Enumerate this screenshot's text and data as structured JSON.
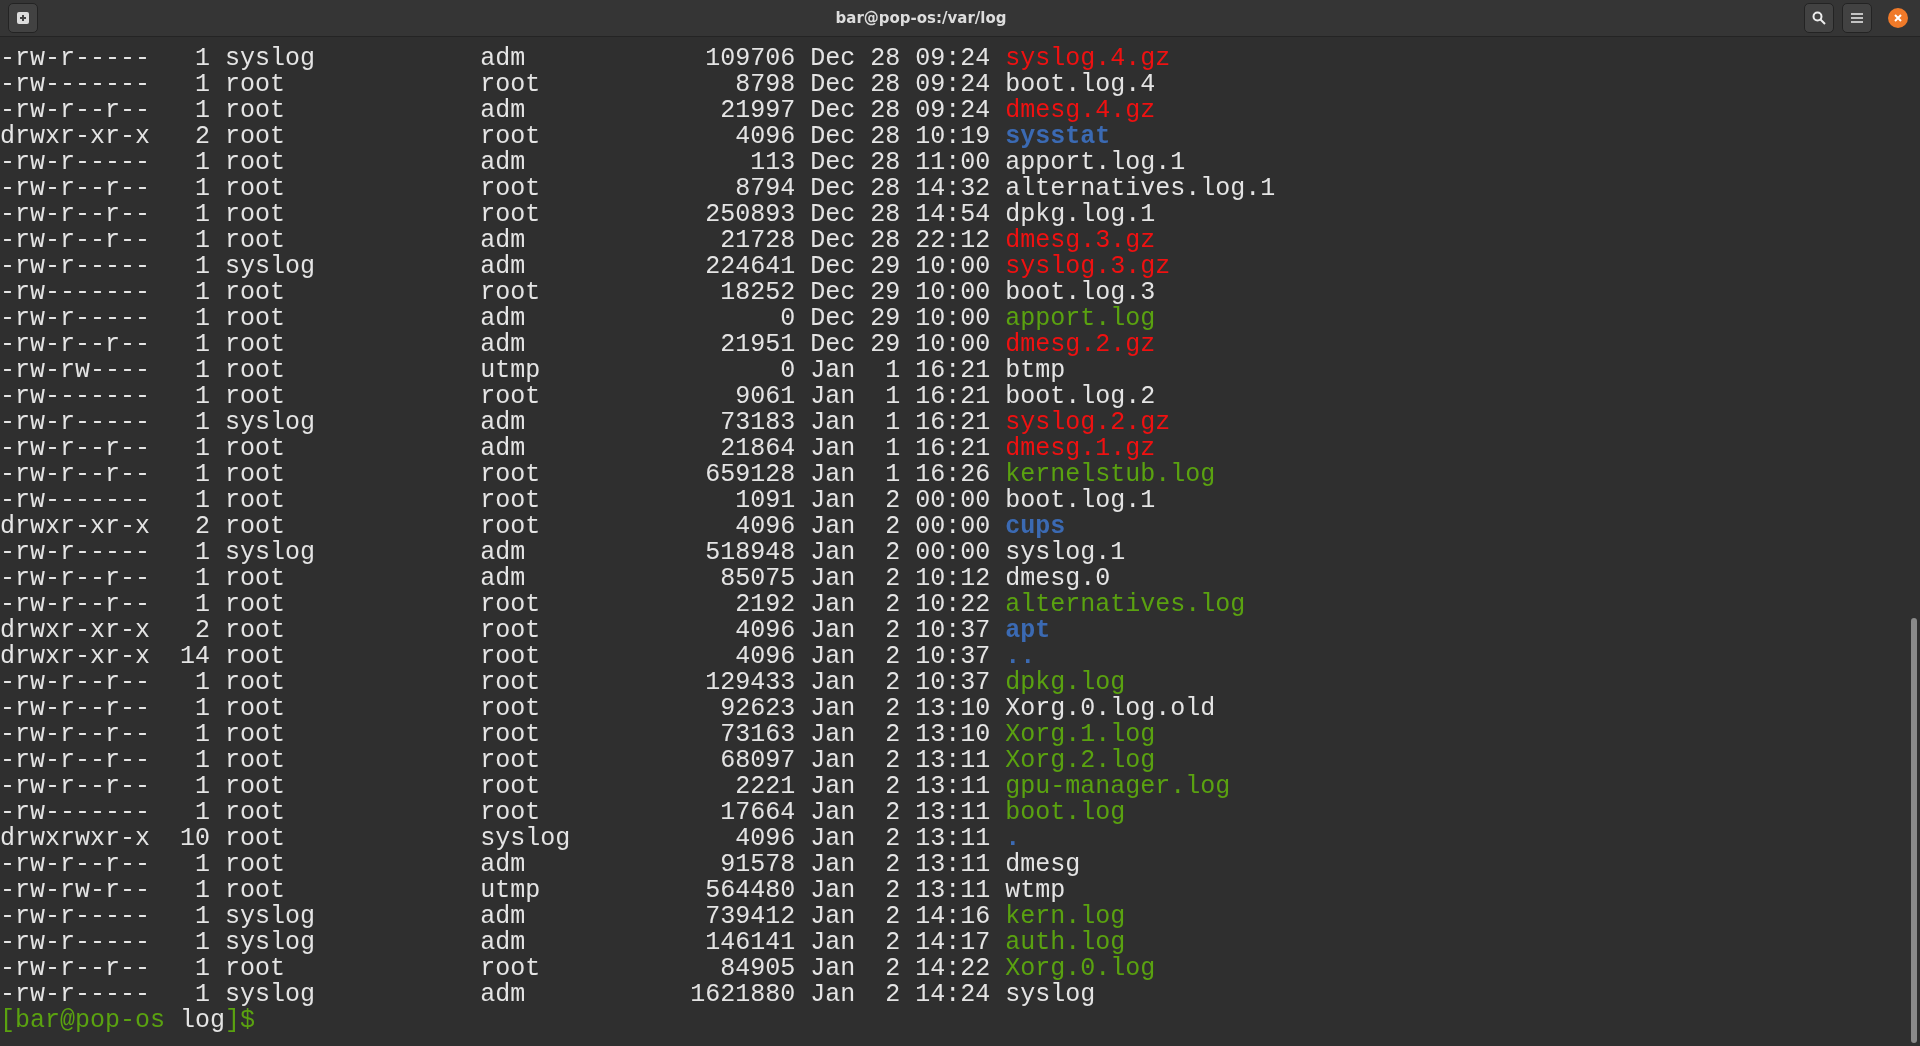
{
  "window": {
    "title": "bar@pop-os:/var/log"
  },
  "listing": [
    {
      "permissions": "-rw-r-----",
      "links": "1",
      "owner": "syslog",
      "group": "adm",
      "size": "109706",
      "month": "Dec",
      "day": "28",
      "time": "09:24",
      "name": "syslog.4.gz",
      "kind": "archive"
    },
    {
      "permissions": "-rw-------",
      "links": "1",
      "owner": "root",
      "group": "root",
      "size": "8798",
      "month": "Dec",
      "day": "28",
      "time": "09:24",
      "name": "boot.log.4",
      "kind": "file"
    },
    {
      "permissions": "-rw-r--r--",
      "links": "1",
      "owner": "root",
      "group": "adm",
      "size": "21997",
      "month": "Dec",
      "day": "28",
      "time": "09:24",
      "name": "dmesg.4.gz",
      "kind": "archive"
    },
    {
      "permissions": "drwxr-xr-x",
      "links": "2",
      "owner": "root",
      "group": "root",
      "size": "4096",
      "month": "Dec",
      "day": "28",
      "time": "10:19",
      "name": "sysstat",
      "kind": "directory"
    },
    {
      "permissions": "-rw-r-----",
      "links": "1",
      "owner": "root",
      "group": "adm",
      "size": "113",
      "month": "Dec",
      "day": "28",
      "time": "11:00",
      "name": "apport.log.1",
      "kind": "file"
    },
    {
      "permissions": "-rw-r--r--",
      "links": "1",
      "owner": "root",
      "group": "root",
      "size": "8794",
      "month": "Dec",
      "day": "28",
      "time": "14:32",
      "name": "alternatives.log.1",
      "kind": "file"
    },
    {
      "permissions": "-rw-r--r--",
      "links": "1",
      "owner": "root",
      "group": "root",
      "size": "250893",
      "month": "Dec",
      "day": "28",
      "time": "14:54",
      "name": "dpkg.log.1",
      "kind": "file"
    },
    {
      "permissions": "-rw-r--r--",
      "links": "1",
      "owner": "root",
      "group": "adm",
      "size": "21728",
      "month": "Dec",
      "day": "28",
      "time": "22:12",
      "name": "dmesg.3.gz",
      "kind": "archive"
    },
    {
      "permissions": "-rw-r-----",
      "links": "1",
      "owner": "syslog",
      "group": "adm",
      "size": "224641",
      "month": "Dec",
      "day": "29",
      "time": "10:00",
      "name": "syslog.3.gz",
      "kind": "archive"
    },
    {
      "permissions": "-rw-------",
      "links": "1",
      "owner": "root",
      "group": "root",
      "size": "18252",
      "month": "Dec",
      "day": "29",
      "time": "10:00",
      "name": "boot.log.3",
      "kind": "file"
    },
    {
      "permissions": "-rw-r-----",
      "links": "1",
      "owner": "root",
      "group": "adm",
      "size": "0",
      "month": "Dec",
      "day": "29",
      "time": "10:00",
      "name": "apport.log",
      "kind": "executable"
    },
    {
      "permissions": "-rw-r--r--",
      "links": "1",
      "owner": "root",
      "group": "adm",
      "size": "21951",
      "month": "Dec",
      "day": "29",
      "time": "10:00",
      "name": "dmesg.2.gz",
      "kind": "archive"
    },
    {
      "permissions": "-rw-rw----",
      "links": "1",
      "owner": "root",
      "group": "utmp",
      "size": "0",
      "month": "Jan",
      "day": "1",
      "time": "16:21",
      "name": "btmp",
      "kind": "file"
    },
    {
      "permissions": "-rw-------",
      "links": "1",
      "owner": "root",
      "group": "root",
      "size": "9061",
      "month": "Jan",
      "day": "1",
      "time": "16:21",
      "name": "boot.log.2",
      "kind": "file"
    },
    {
      "permissions": "-rw-r-----",
      "links": "1",
      "owner": "syslog",
      "group": "adm",
      "size": "73183",
      "month": "Jan",
      "day": "1",
      "time": "16:21",
      "name": "syslog.2.gz",
      "kind": "archive"
    },
    {
      "permissions": "-rw-r--r--",
      "links": "1",
      "owner": "root",
      "group": "adm",
      "size": "21864",
      "month": "Jan",
      "day": "1",
      "time": "16:21",
      "name": "dmesg.1.gz",
      "kind": "archive"
    },
    {
      "permissions": "-rw-r--r--",
      "links": "1",
      "owner": "root",
      "group": "root",
      "size": "659128",
      "month": "Jan",
      "day": "1",
      "time": "16:26",
      "name": "kernelstub.log",
      "kind": "executable"
    },
    {
      "permissions": "-rw-------",
      "links": "1",
      "owner": "root",
      "group": "root",
      "size": "1091",
      "month": "Jan",
      "day": "2",
      "time": "00:00",
      "name": "boot.log.1",
      "kind": "file"
    },
    {
      "permissions": "drwxr-xr-x",
      "links": "2",
      "owner": "root",
      "group": "root",
      "size": "4096",
      "month": "Jan",
      "day": "2",
      "time": "00:00",
      "name": "cups",
      "kind": "directory"
    },
    {
      "permissions": "-rw-r-----",
      "links": "1",
      "owner": "syslog",
      "group": "adm",
      "size": "518948",
      "month": "Jan",
      "day": "2",
      "time": "00:00",
      "name": "syslog.1",
      "kind": "file"
    },
    {
      "permissions": "-rw-r--r--",
      "links": "1",
      "owner": "root",
      "group": "adm",
      "size": "85075",
      "month": "Jan",
      "day": "2",
      "time": "10:12",
      "name": "dmesg.0",
      "kind": "file"
    },
    {
      "permissions": "-rw-r--r--",
      "links": "1",
      "owner": "root",
      "group": "root",
      "size": "2192",
      "month": "Jan",
      "day": "2",
      "time": "10:22",
      "name": "alternatives.log",
      "kind": "executable"
    },
    {
      "permissions": "drwxr-xr-x",
      "links": "2",
      "owner": "root",
      "group": "root",
      "size": "4096",
      "month": "Jan",
      "day": "2",
      "time": "10:37",
      "name": "apt",
      "kind": "directory"
    },
    {
      "permissions": "drwxr-xr-x",
      "links": "14",
      "owner": "root",
      "group": "root",
      "size": "4096",
      "month": "Jan",
      "day": "2",
      "time": "10:37",
      "name": "..",
      "kind": "directory"
    },
    {
      "permissions": "-rw-r--r--",
      "links": "1",
      "owner": "root",
      "group": "root",
      "size": "129433",
      "month": "Jan",
      "day": "2",
      "time": "10:37",
      "name": "dpkg.log",
      "kind": "executable"
    },
    {
      "permissions": "-rw-r--r--",
      "links": "1",
      "owner": "root",
      "group": "root",
      "size": "92623",
      "month": "Jan",
      "day": "2",
      "time": "13:10",
      "name": "Xorg.0.log.old",
      "kind": "file"
    },
    {
      "permissions": "-rw-r--r--",
      "links": "1",
      "owner": "root",
      "group": "root",
      "size": "73163",
      "month": "Jan",
      "day": "2",
      "time": "13:10",
      "name": "Xorg.1.log",
      "kind": "executable"
    },
    {
      "permissions": "-rw-r--r--",
      "links": "1",
      "owner": "root",
      "group": "root",
      "size": "68097",
      "month": "Jan",
      "day": "2",
      "time": "13:11",
      "name": "Xorg.2.log",
      "kind": "executable"
    },
    {
      "permissions": "-rw-r--r--",
      "links": "1",
      "owner": "root",
      "group": "root",
      "size": "2221",
      "month": "Jan",
      "day": "2",
      "time": "13:11",
      "name": "gpu-manager.log",
      "kind": "executable"
    },
    {
      "permissions": "-rw-------",
      "links": "1",
      "owner": "root",
      "group": "root",
      "size": "17664",
      "month": "Jan",
      "day": "2",
      "time": "13:11",
      "name": "boot.log",
      "kind": "executable"
    },
    {
      "permissions": "drwxrwxr-x",
      "links": "10",
      "owner": "root",
      "group": "syslog",
      "size": "4096",
      "month": "Jan",
      "day": "2",
      "time": "13:11",
      "name": ".",
      "kind": "directory"
    },
    {
      "permissions": "-rw-r--r--",
      "links": "1",
      "owner": "root",
      "group": "adm",
      "size": "91578",
      "month": "Jan",
      "day": "2",
      "time": "13:11",
      "name": "dmesg",
      "kind": "file"
    },
    {
      "permissions": "-rw-rw-r--",
      "links": "1",
      "owner": "root",
      "group": "utmp",
      "size": "564480",
      "month": "Jan",
      "day": "2",
      "time": "13:11",
      "name": "wtmp",
      "kind": "file"
    },
    {
      "permissions": "-rw-r-----",
      "links": "1",
      "owner": "syslog",
      "group": "adm",
      "size": "739412",
      "month": "Jan",
      "day": "2",
      "time": "14:16",
      "name": "kern.log",
      "kind": "executable"
    },
    {
      "permissions": "-rw-r-----",
      "links": "1",
      "owner": "syslog",
      "group": "adm",
      "size": "146141",
      "month": "Jan",
      "day": "2",
      "time": "14:17",
      "name": "auth.log",
      "kind": "executable"
    },
    {
      "permissions": "-rw-r--r--",
      "links": "1",
      "owner": "root",
      "group": "root",
      "size": "84905",
      "month": "Jan",
      "day": "2",
      "time": "14:22",
      "name": "Xorg.0.log",
      "kind": "executable"
    },
    {
      "permissions": "-rw-r-----",
      "links": "1",
      "owner": "syslog",
      "group": "adm",
      "size": "1621880",
      "month": "Jan",
      "day": "2",
      "time": "14:24",
      "name": "syslog",
      "kind": "file"
    }
  ],
  "prompt": {
    "open": "[",
    "user_host": "bar@pop-os",
    "directory": "log",
    "close": "]$"
  }
}
